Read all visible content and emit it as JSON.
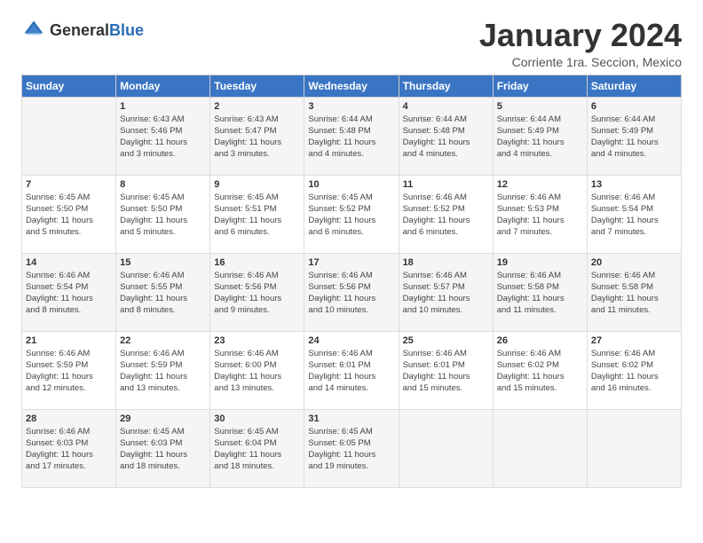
{
  "header": {
    "logo_general": "General",
    "logo_blue": "Blue",
    "month_title": "January 2024",
    "location": "Corriente 1ra. Seccion, Mexico"
  },
  "weekdays": [
    "Sunday",
    "Monday",
    "Tuesday",
    "Wednesday",
    "Thursday",
    "Friday",
    "Saturday"
  ],
  "weeks": [
    [
      {
        "day": "",
        "info": ""
      },
      {
        "day": "1",
        "info": "Sunrise: 6:43 AM\nSunset: 5:46 PM\nDaylight: 11 hours\nand 3 minutes."
      },
      {
        "day": "2",
        "info": "Sunrise: 6:43 AM\nSunset: 5:47 PM\nDaylight: 11 hours\nand 3 minutes."
      },
      {
        "day": "3",
        "info": "Sunrise: 6:44 AM\nSunset: 5:48 PM\nDaylight: 11 hours\nand 4 minutes."
      },
      {
        "day": "4",
        "info": "Sunrise: 6:44 AM\nSunset: 5:48 PM\nDaylight: 11 hours\nand 4 minutes."
      },
      {
        "day": "5",
        "info": "Sunrise: 6:44 AM\nSunset: 5:49 PM\nDaylight: 11 hours\nand 4 minutes."
      },
      {
        "day": "6",
        "info": "Sunrise: 6:44 AM\nSunset: 5:49 PM\nDaylight: 11 hours\nand 4 minutes."
      }
    ],
    [
      {
        "day": "7",
        "info": "Sunrise: 6:45 AM\nSunset: 5:50 PM\nDaylight: 11 hours\nand 5 minutes."
      },
      {
        "day": "8",
        "info": "Sunrise: 6:45 AM\nSunset: 5:50 PM\nDaylight: 11 hours\nand 5 minutes."
      },
      {
        "day": "9",
        "info": "Sunrise: 6:45 AM\nSunset: 5:51 PM\nDaylight: 11 hours\nand 6 minutes."
      },
      {
        "day": "10",
        "info": "Sunrise: 6:45 AM\nSunset: 5:52 PM\nDaylight: 11 hours\nand 6 minutes."
      },
      {
        "day": "11",
        "info": "Sunrise: 6:46 AM\nSunset: 5:52 PM\nDaylight: 11 hours\nand 6 minutes."
      },
      {
        "day": "12",
        "info": "Sunrise: 6:46 AM\nSunset: 5:53 PM\nDaylight: 11 hours\nand 7 minutes."
      },
      {
        "day": "13",
        "info": "Sunrise: 6:46 AM\nSunset: 5:54 PM\nDaylight: 11 hours\nand 7 minutes."
      }
    ],
    [
      {
        "day": "14",
        "info": "Sunrise: 6:46 AM\nSunset: 5:54 PM\nDaylight: 11 hours\nand 8 minutes."
      },
      {
        "day": "15",
        "info": "Sunrise: 6:46 AM\nSunset: 5:55 PM\nDaylight: 11 hours\nand 8 minutes."
      },
      {
        "day": "16",
        "info": "Sunrise: 6:46 AM\nSunset: 5:56 PM\nDaylight: 11 hours\nand 9 minutes."
      },
      {
        "day": "17",
        "info": "Sunrise: 6:46 AM\nSunset: 5:56 PM\nDaylight: 11 hours\nand 10 minutes."
      },
      {
        "day": "18",
        "info": "Sunrise: 6:46 AM\nSunset: 5:57 PM\nDaylight: 11 hours\nand 10 minutes."
      },
      {
        "day": "19",
        "info": "Sunrise: 6:46 AM\nSunset: 5:58 PM\nDaylight: 11 hours\nand 11 minutes."
      },
      {
        "day": "20",
        "info": "Sunrise: 6:46 AM\nSunset: 5:58 PM\nDaylight: 11 hours\nand 11 minutes."
      }
    ],
    [
      {
        "day": "21",
        "info": "Sunrise: 6:46 AM\nSunset: 5:59 PM\nDaylight: 11 hours\nand 12 minutes."
      },
      {
        "day": "22",
        "info": "Sunrise: 6:46 AM\nSunset: 5:59 PM\nDaylight: 11 hours\nand 13 minutes."
      },
      {
        "day": "23",
        "info": "Sunrise: 6:46 AM\nSunset: 6:00 PM\nDaylight: 11 hours\nand 13 minutes."
      },
      {
        "day": "24",
        "info": "Sunrise: 6:46 AM\nSunset: 6:01 PM\nDaylight: 11 hours\nand 14 minutes."
      },
      {
        "day": "25",
        "info": "Sunrise: 6:46 AM\nSunset: 6:01 PM\nDaylight: 11 hours\nand 15 minutes."
      },
      {
        "day": "26",
        "info": "Sunrise: 6:46 AM\nSunset: 6:02 PM\nDaylight: 11 hours\nand 15 minutes."
      },
      {
        "day": "27",
        "info": "Sunrise: 6:46 AM\nSunset: 6:02 PM\nDaylight: 11 hours\nand 16 minutes."
      }
    ],
    [
      {
        "day": "28",
        "info": "Sunrise: 6:46 AM\nSunset: 6:03 PM\nDaylight: 11 hours\nand 17 minutes."
      },
      {
        "day": "29",
        "info": "Sunrise: 6:45 AM\nSunset: 6:03 PM\nDaylight: 11 hours\nand 18 minutes."
      },
      {
        "day": "30",
        "info": "Sunrise: 6:45 AM\nSunset: 6:04 PM\nDaylight: 11 hours\nand 18 minutes."
      },
      {
        "day": "31",
        "info": "Sunrise: 6:45 AM\nSunset: 6:05 PM\nDaylight: 11 hours\nand 19 minutes."
      },
      {
        "day": "",
        "info": ""
      },
      {
        "day": "",
        "info": ""
      },
      {
        "day": "",
        "info": ""
      }
    ]
  ]
}
